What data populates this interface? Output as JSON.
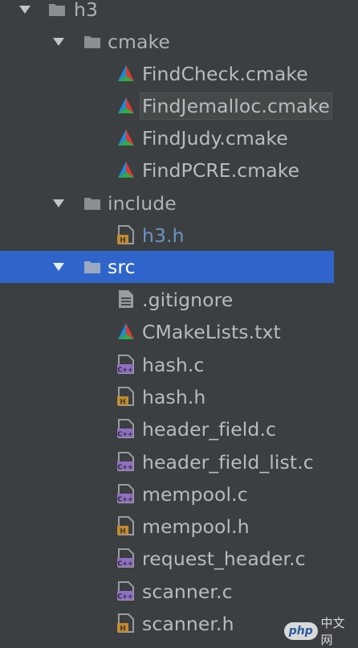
{
  "tree": {
    "root": {
      "name": "h3",
      "expanded": true
    },
    "cmake_folder": {
      "name": "cmake",
      "expanded": true
    },
    "cmake_files": [
      "FindCheck.cmake",
      "FindJemalloc.cmake",
      "FindJudy.cmake",
      "FindPCRE.cmake"
    ],
    "include_folder": {
      "name": "include",
      "expanded": true
    },
    "include_files": [
      "h3.h"
    ],
    "src_folder": {
      "name": "src",
      "expanded": true,
      "selected": true
    },
    "src_files": [
      {
        "name": ".gitignore",
        "icon": "text-file-icon"
      },
      {
        "name": "CMakeLists.txt",
        "icon": "cmake-icon"
      },
      {
        "name": "hash.c",
        "icon": "c-source-icon"
      },
      {
        "name": "hash.h",
        "icon": "header-file-icon"
      },
      {
        "name": "header_field.c",
        "icon": "c-source-icon"
      },
      {
        "name": "header_field_list.c",
        "icon": "c-source-icon"
      },
      {
        "name": "mempool.c",
        "icon": "c-source-icon"
      },
      {
        "name": "mempool.h",
        "icon": "header-file-icon"
      },
      {
        "name": "request_header.c",
        "icon": "c-source-icon"
      },
      {
        "name": "scanner.c",
        "icon": "c-source-icon"
      },
      {
        "name": "scanner.h",
        "icon": "header-file-icon"
      }
    ]
  },
  "icon_badges": {
    "c_source": "C++",
    "header": "H"
  },
  "colors": {
    "background": "#3c3f41",
    "selection": "#2f65ca",
    "text": "#b8bcbf",
    "header_link": "#6c93c7",
    "folder": "#8c8f91",
    "c_badge": "#8f6fc4",
    "h_badge": "#c58a2a"
  },
  "watermark": {
    "badge": "php",
    "text": "中文网"
  }
}
